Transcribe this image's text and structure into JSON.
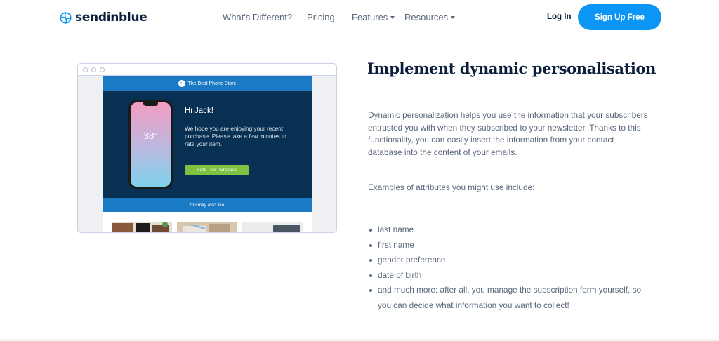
{
  "nav": {
    "logo_text": "sendinblue",
    "links": [
      {
        "label": "What's Different?"
      },
      {
        "label": "Pricing"
      },
      {
        "label": "Features"
      },
      {
        "label": "Resources"
      }
    ],
    "login": "Log In",
    "signup": "Sign Up Free"
  },
  "mockup": {
    "store_name": "The Best Phone Store",
    "temperature": "38°",
    "greeting": "Hi Jack!",
    "message": "We hope you are enjoying your recent purchase. Please take a few minutes to rate your item.",
    "button": "Rate This Purchase",
    "also_like": "You may also like:"
  },
  "content": {
    "heading": "Implement dynamic personalisation",
    "paragraph": "Dynamic personalization helps you use the information that your subscribers entrusted you with when they subscribed to your newsletter. Thanks to this functionality, you can easily insert the information from your contact database into the content of your emails.",
    "examples_intro": "Examples of attributes you might use include:",
    "attributes": [
      "last name",
      "first name",
      "gender preference",
      "date of birth",
      "and much more: after all, you manage the subscription form yourself, so you can decide what information you want to collect!"
    ]
  },
  "colors": {
    "brand_blue": "#0b96f5",
    "navy": "#0b1e3c",
    "email_blue": "#1b7ac4",
    "email_dark": "#073052",
    "cta_green": "#7ec242"
  }
}
